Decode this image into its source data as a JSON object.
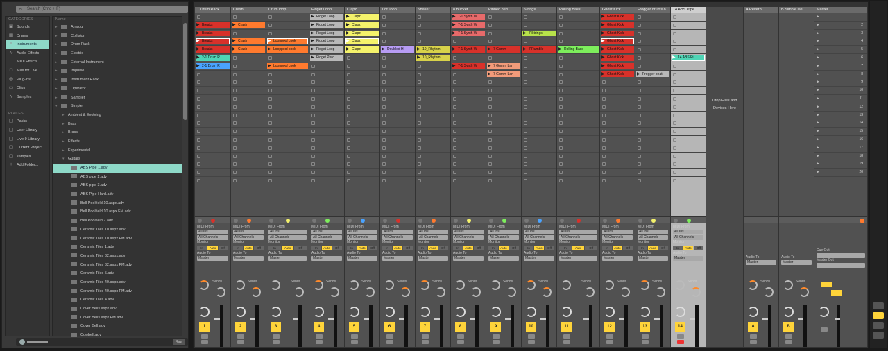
{
  "browser": {
    "search_placeholder": "Search (Cmd + F)",
    "categories_header": "CATEGORIES",
    "categories": [
      {
        "label": "Sounds",
        "icon": "speaker-icon"
      },
      {
        "label": "Drums",
        "icon": "drum-icon"
      },
      {
        "label": "Instruments",
        "icon": "keys-icon",
        "selected": true
      },
      {
        "label": "Audio Effects",
        "icon": "wave-icon"
      },
      {
        "label": "MIDI Effects",
        "icon": "midi-icon"
      },
      {
        "label": "Max for Live",
        "icon": "max-icon"
      },
      {
        "label": "Plug-ins",
        "icon": "plug-icon"
      },
      {
        "label": "Clips",
        "icon": "clip-icon"
      },
      {
        "label": "Samples",
        "icon": "sample-icon"
      }
    ],
    "places_header": "PLACES",
    "places": [
      {
        "label": "Packs",
        "icon": "pack-icon"
      },
      {
        "label": "User Library",
        "icon": "library-icon"
      },
      {
        "label": "Live 9 Library",
        "icon": "library-icon"
      },
      {
        "label": "Current Project",
        "icon": "project-icon"
      },
      {
        "label": "samples",
        "icon": "folder-icon"
      },
      {
        "label": "Add Folder...",
        "icon": "plus-icon"
      }
    ],
    "list_header": "Name",
    "items": [
      {
        "label": "Analog",
        "kind": "folder"
      },
      {
        "label": "Collision",
        "kind": "folder"
      },
      {
        "label": "Drum Rack",
        "kind": "folder"
      },
      {
        "label": "Electric",
        "kind": "folder"
      },
      {
        "label": "External Instrument",
        "kind": "folder"
      },
      {
        "label": "Impulse",
        "kind": "folder"
      },
      {
        "label": "Instrument Rack",
        "kind": "folder"
      },
      {
        "label": "Operator",
        "kind": "folder"
      },
      {
        "label": "Sampler",
        "kind": "folder"
      },
      {
        "label": "Simpler",
        "kind": "folder",
        "open": true
      },
      {
        "label": "Ambient & Evolving",
        "kind": "sub"
      },
      {
        "label": "Bass",
        "kind": "sub"
      },
      {
        "label": "Brass",
        "kind": "sub"
      },
      {
        "label": "Effects",
        "kind": "sub"
      },
      {
        "label": "Experimental",
        "kind": "sub"
      },
      {
        "label": "Guitars",
        "kind": "sub",
        "open": true
      },
      {
        "label": "ABS Pipe 1.adv",
        "kind": "file",
        "selected": true
      },
      {
        "label": "ABS pipe 2.adv",
        "kind": "file"
      },
      {
        "label": "ABS pipe 3.adv",
        "kind": "file"
      },
      {
        "label": "ABS Pipe Hard.adv",
        "kind": "file"
      },
      {
        "label": "Bell Poolfield 10.aspx.adv",
        "kind": "file"
      },
      {
        "label": "Bell Poolfield 10.aspx FM.adv",
        "kind": "file"
      },
      {
        "label": "Bell Poolfield 7.adv",
        "kind": "file"
      },
      {
        "label": "Ceramic Tiles 10.aspx.adv",
        "kind": "file"
      },
      {
        "label": "Ceramic Tiles 10.aspx FM.adv",
        "kind": "file"
      },
      {
        "label": "Ceramic Tiles 1.adv",
        "kind": "file"
      },
      {
        "label": "Ceramic Tiles 32.aspx.adv",
        "kind": "file"
      },
      {
        "label": "Ceramic Tiles 32.aspx FM.adv",
        "kind": "file"
      },
      {
        "label": "Ceramic Tiles 5.adv",
        "kind": "file"
      },
      {
        "label": "Ceramic Tiles 40.aspx.adv",
        "kind": "file"
      },
      {
        "label": "Ceramic Tiles 40.aspx FM.adv",
        "kind": "file"
      },
      {
        "label": "Ceramic Tiles 4.adv",
        "kind": "file"
      },
      {
        "label": "Cover Bells.aspx.adv",
        "kind": "file"
      },
      {
        "label": "Cover Bells.aspx FM.adv",
        "kind": "file"
      },
      {
        "label": "Cover Bell.adv",
        "kind": "file"
      },
      {
        "label": "Cowbell.adv",
        "kind": "file"
      }
    ],
    "preview_raw": "Raw"
  },
  "drop_text": [
    "Drop Files and",
    "Devices Here"
  ],
  "io_labels": {
    "midi_from": "MIDI From",
    "audio_from": "Audio From",
    "all_ins": "All Ins",
    "all_channels": "All Channels",
    "monitor": "Monitor",
    "monitor_in": "In",
    "monitor_auto": "Auto",
    "monitor_off": "Off",
    "audio_to": "Audio To",
    "master": "Master",
    "sends": "Sends",
    "cue_out": "Cue Out",
    "master_out": "Master Out"
  },
  "colors": {
    "orange": "#ff7a2e",
    "red": "#d8312a",
    "yellow": "#f4f26b",
    "green": "#7dee5c",
    "purple": "#b79cf4",
    "blue": "#4aa3ff",
    "teal": "#4fd4b5",
    "pink": "#e76a6a",
    "lime": "#b8e24a",
    "olive": "#d8d24a",
    "salmon": "#f29b7a",
    "grey": "#b8b8b8"
  },
  "tracks": [
    {
      "name": "1 Drum Rack",
      "num": "1",
      "clips": [
        {
          "row": 1,
          "label": "Breaks",
          "color": "red"
        },
        {
          "row": 2,
          "label": "Breaks",
          "color": "red"
        },
        {
          "row": 3,
          "label": "Breaks",
          "color": "red",
          "play": true
        },
        {
          "row": 4,
          "label": "Breaks",
          "color": "red"
        },
        {
          "row": 5,
          "label": "2-1 Drum R",
          "color": "teal"
        },
        {
          "row": 6,
          "label": "2-1 Drum R",
          "color": "blue"
        }
      ]
    },
    {
      "name": "Crash",
      "num": "2",
      "clips": [
        {
          "row": 1,
          "label": "Crash",
          "color": "orange"
        },
        {
          "row": 3,
          "label": "Crash",
          "color": "orange"
        },
        {
          "row": 4,
          "label": "Crash",
          "color": "orange"
        }
      ]
    },
    {
      "name": "Drum loop",
      "num": "3",
      "clips": [
        {
          "row": 3,
          "label": "Looppool cook",
          "color": "orange",
          "play": true
        },
        {
          "row": 4,
          "label": "Looppool cook",
          "color": "orange"
        },
        {
          "row": 6,
          "label": "Looppool cook",
          "color": "orange"
        }
      ]
    },
    {
      "name": "Fidget Loop",
      "num": "4",
      "clips": [
        {
          "row": 0,
          "label": "Fidget Loop",
          "color": "grey"
        },
        {
          "row": 1,
          "label": "Fidget Loop",
          "color": "grey"
        },
        {
          "row": 2,
          "label": "Fidget Loop",
          "color": "grey"
        },
        {
          "row": 3,
          "label": "Fidget Loop",
          "color": "grey"
        },
        {
          "row": 4,
          "label": "Fidget Loop",
          "color": "grey"
        },
        {
          "row": 5,
          "label": "Fidget Perc",
          "color": "grey"
        }
      ]
    },
    {
      "name": "Clapz",
      "num": "5",
      "clips": [
        {
          "row": 0,
          "label": "Clapz",
          "color": "yellow"
        },
        {
          "row": 1,
          "label": "Clapz",
          "color": "yellow"
        },
        {
          "row": 2,
          "label": "Clapz",
          "color": "yellow"
        },
        {
          "row": 3,
          "label": "Clapz",
          "color": "yellow",
          "play": true
        },
        {
          "row": 4,
          "label": "Clapz",
          "color": "yellow"
        }
      ]
    },
    {
      "name": "Lofi loop",
      "num": "6",
      "clips": [
        {
          "row": 4,
          "label": "Doubled H",
          "color": "purple"
        }
      ]
    },
    {
      "name": "Shaker",
      "num": "7",
      "clips": [
        {
          "row": 4,
          "label": "10_Rhythm",
          "color": "olive"
        },
        {
          "row": 5,
          "label": "10_Rhythm",
          "color": "olive"
        }
      ]
    },
    {
      "name": "8 Bucket",
      "num": "8",
      "clips": [
        {
          "row": 0,
          "label": "7-1 Synth W",
          "color": "pink"
        },
        {
          "row": 1,
          "label": "7-1 Synth W",
          "color": "pink"
        },
        {
          "row": 2,
          "label": "7-1 Synth W",
          "color": "pink"
        },
        {
          "row": 4,
          "label": "7-1 Synth W",
          "color": "red"
        },
        {
          "row": 6,
          "label": "7-1 Synth W",
          "color": "red"
        }
      ]
    },
    {
      "name": "Pinned bed",
      "num": "9",
      "clips": [
        {
          "row": 4,
          "label": "7 Gumm",
          "color": "red"
        },
        {
          "row": 6,
          "label": "7 Gumm Lan",
          "color": "salmon"
        },
        {
          "row": 7,
          "label": "7 Gumm Lan",
          "color": "salmon"
        }
      ]
    },
    {
      "name": "Strings",
      "num": "10",
      "clips": [
        {
          "row": 2,
          "label": "7 Strings",
          "color": "lime"
        },
        {
          "row": 4,
          "label": "7 Rumble",
          "color": "red"
        }
      ]
    },
    {
      "name": "Rolling Bass",
      "num": "11",
      "clips": [
        {
          "row": 4,
          "label": "Rolling Bass",
          "color": "green"
        }
      ]
    },
    {
      "name": "Ghost Kick",
      "num": "12",
      "clips": [
        {
          "row": 0,
          "label": "Ghost Kick",
          "color": "red"
        },
        {
          "row": 1,
          "label": "Ghost Kick",
          "color": "red"
        },
        {
          "row": 2,
          "label": "Ghost Kick",
          "color": "red"
        },
        {
          "row": 3,
          "label": "Ghost Kick",
          "color": "red",
          "play": true
        },
        {
          "row": 4,
          "label": "Ghost Kick",
          "color": "red"
        },
        {
          "row": 5,
          "label": "Ghost Kick",
          "color": "red"
        },
        {
          "row": 6,
          "label": "Ghost Kick",
          "color": "red"
        },
        {
          "row": 7,
          "label": "Ghost Kick",
          "color": "red"
        }
      ]
    },
    {
      "name": "Frogger drums 8",
      "num": "13",
      "clips": [
        {
          "row": 7,
          "label": "Frogger beat",
          "color": "grey"
        }
      ]
    },
    {
      "name": "14 ABS Pipe",
      "num": "14",
      "selected": true,
      "clips": [
        {
          "row": 5,
          "label": "14 ABS Pi",
          "color": "teal",
          "play": true
        }
      ]
    }
  ],
  "returns": [
    {
      "name": "A Reverb",
      "num": "A"
    },
    {
      "name": "B Simple Del",
      "num": "B"
    }
  ],
  "master": {
    "name": "Master",
    "scenes": [
      "1",
      "2",
      "3",
      "4",
      "5",
      "6",
      "7",
      "8",
      "9",
      "10",
      "11",
      "12",
      "13",
      "14",
      "15",
      "16",
      "17",
      "18",
      "19",
      "20"
    ]
  }
}
